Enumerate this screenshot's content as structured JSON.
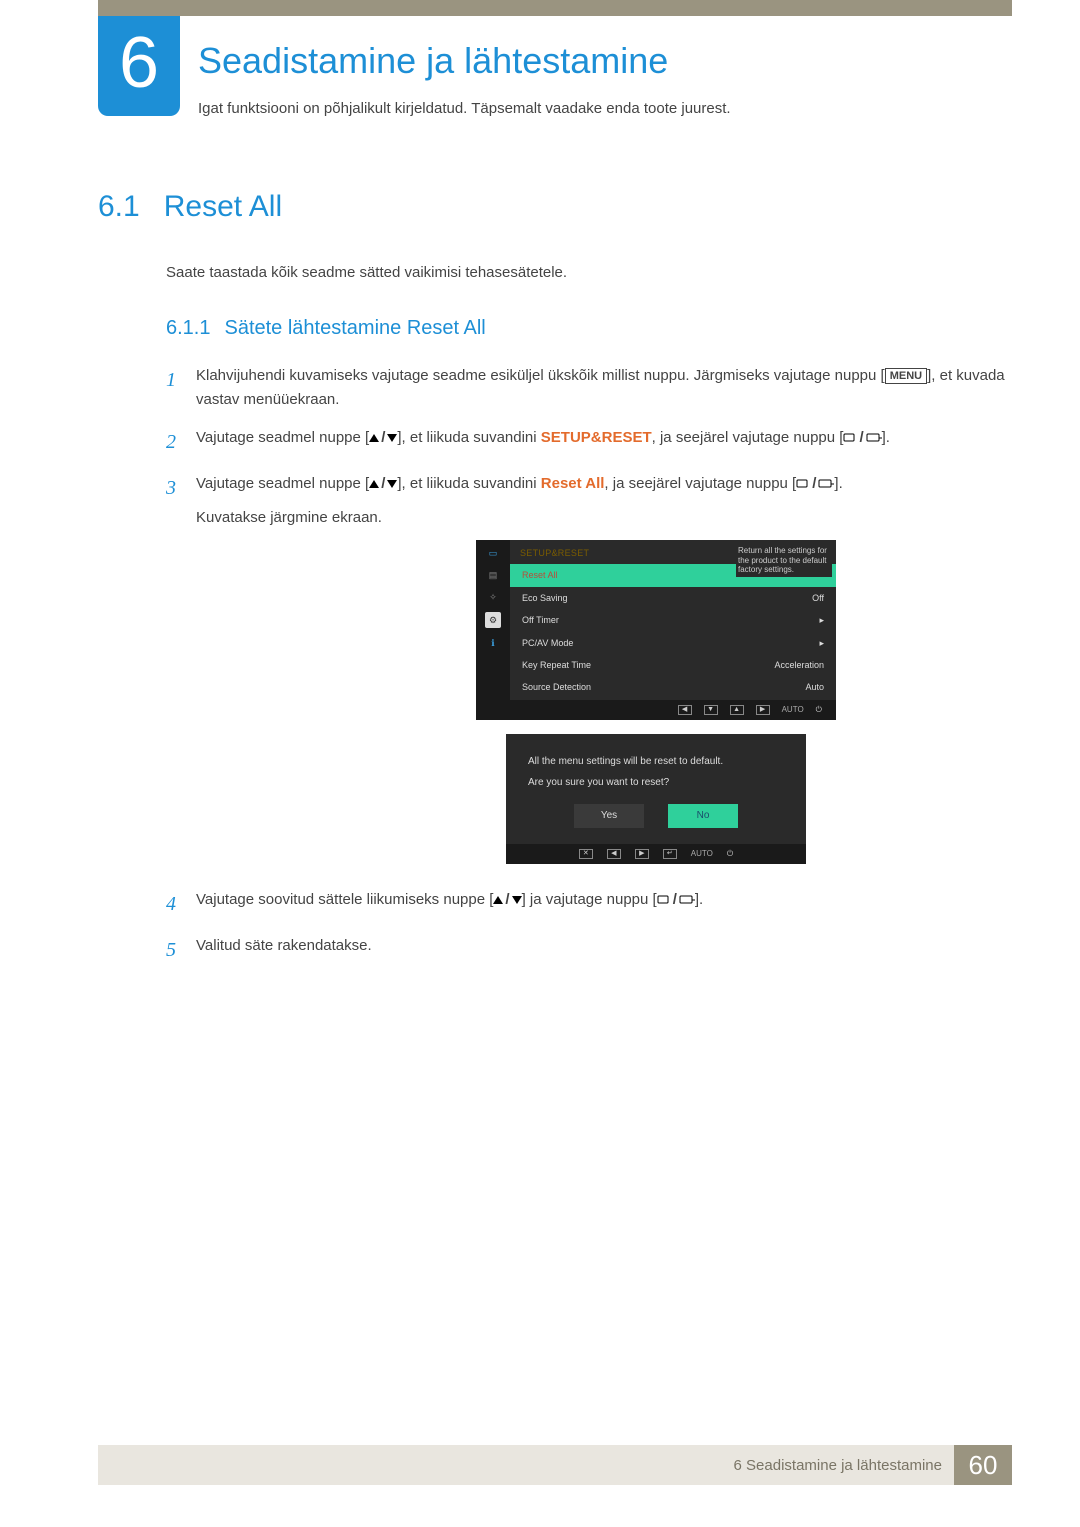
{
  "chapter": {
    "number": "6",
    "title": "Seadistamine ja lähtestamine",
    "subtitle": "Igat funktsiooni on põhjalikult kirjeldatud. Täpsemalt vaadake enda toote juurest."
  },
  "section": {
    "number": "6.1",
    "title": "Reset All",
    "description": "Saate taastada kõik seadme sätted vaikimisi tehasesätetele."
  },
  "subsection": {
    "number": "6.1.1",
    "title": "Sätete lähtestamine Reset All"
  },
  "steps": {
    "s1": {
      "num": "1",
      "pre": "Klahvijuhendi kuvamiseks vajutage seadme esiküljel ükskõik millist nuppu. Järgmiseks vajutage nuppu [",
      "menu": "MENU",
      "post": "], et kuvada vastav menüüekraan."
    },
    "s2": {
      "num": "2",
      "pre": "Vajutage seadmel nuppe [",
      "mid": "], et liikuda suvandini ",
      "hl": "SETUP&RESET",
      "post": ", ja seejärel vajutage nuppu ["
    },
    "s2b": "].",
    "s3": {
      "num": "3",
      "pre": "Vajutage seadmel nuppe [",
      "mid": "], et liikuda suvandini ",
      "hl": "Reset All",
      "post1": ", ja seejärel vajutage nuppu [",
      "post2": "].",
      "next": "Kuvatakse järgmine ekraan."
    },
    "s4": {
      "num": "4",
      "pre": "Vajutage soovitud sättele liikumiseks nuppe [",
      "mid": "] ja vajutage nuppu [",
      "post": "]."
    },
    "s5": {
      "num": "5",
      "text": "Valitud säte rakendatakse."
    }
  },
  "osd": {
    "header": "SETUP&RESET",
    "tooltip": "Return all the settings for the product to the default factory settings.",
    "rows": {
      "reset": {
        "label": "Reset All",
        "value": ""
      },
      "eco": {
        "label": "Eco Saving",
        "value": "Off"
      },
      "timer": {
        "label": "Off Timer",
        "value": "▸"
      },
      "pcav": {
        "label": "PC/AV Mode",
        "value": "▸"
      },
      "key": {
        "label": "Key Repeat Time",
        "value": "Acceleration"
      },
      "src": {
        "label": "Source Detection",
        "value": "Auto"
      }
    },
    "nav_auto": "AUTO"
  },
  "confirm": {
    "line1": "All the menu settings will be reset to default.",
    "line2": "Are you sure you want to reset?",
    "yes": "Yes",
    "no": "No",
    "nav_auto": "AUTO"
  },
  "footer": {
    "text": "6 Seadistamine ja lähtestamine",
    "page": "60"
  }
}
